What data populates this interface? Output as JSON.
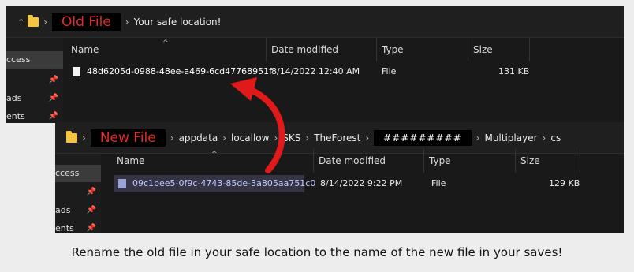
{
  "window_old": {
    "tag": "Old File",
    "breadcrumbs": [
      "Your safe location!"
    ],
    "nav": [
      {
        "label": "ccess",
        "pinned": false,
        "selected": true
      },
      {
        "label": "",
        "pinned": true,
        "selected": false
      },
      {
        "label": "ads",
        "pinned": true,
        "selected": false
      },
      {
        "label": "ents",
        "pinned": true,
        "selected": false
      }
    ],
    "columns": [
      "Name",
      "Date modified",
      "Type",
      "Size"
    ],
    "files": [
      {
        "name": "48d6205d-0988-48ee-a469-6cd47768951f",
        "date": "8/14/2022 12:40 AM",
        "type": "File",
        "size": "131 KB"
      }
    ]
  },
  "window_new": {
    "tag": "New File",
    "breadcrumbs": [
      "appdata",
      "locallow",
      "SKS",
      "TheForest",
      "#########",
      "Multiplayer",
      "cs"
    ],
    "nav": [
      {
        "label": "ccess",
        "pinned": false,
        "selected": true
      },
      {
        "label": "",
        "pinned": true,
        "selected": false
      },
      {
        "label": "ads",
        "pinned": true,
        "selected": false
      },
      {
        "label": "ents",
        "pinned": true,
        "selected": false
      }
    ],
    "columns": [
      "Name",
      "Date modified",
      "Type",
      "Size"
    ],
    "files": [
      {
        "name": "09c1bee5-0f9c-4743-85de-3a805aa751c0",
        "date": "8/14/2022 9:22 PM",
        "type": "File",
        "size": "129 KB"
      }
    ]
  },
  "caption": "Rename the old file in your safe location to the name of the new file in your saves!",
  "colors": {
    "tag_text": "#e8282b",
    "arrow": "#e01a1a",
    "selected_row": "#343445"
  }
}
